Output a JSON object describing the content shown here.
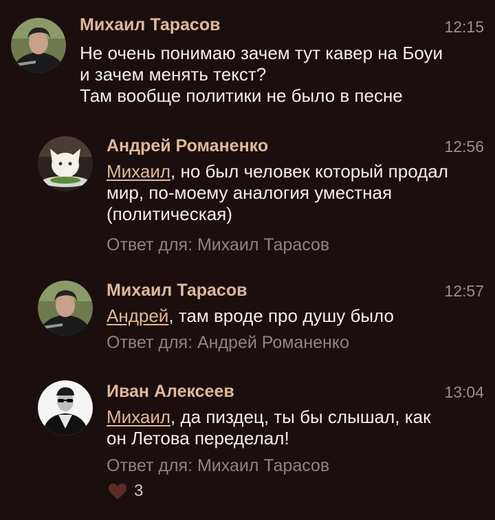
{
  "comments": [
    {
      "author": "Михаил Тарасов",
      "time": "12:15",
      "lines": [
        "Не очень понимаю зачем тут кавер на Боуи",
        "и зачем менять текст?",
        "Там вообще политики не было в песне"
      ],
      "avatar": "man-hoodie-avatar-icon"
    },
    {
      "author": "Андрей Романенко",
      "time": "12:56",
      "mention": "Михаил",
      "text_line1": ", но был человек который продал",
      "text_line2": "мир, по-моему аналогия уместная",
      "text_line3": "(политическая)",
      "reply_to": "Ответ для: Михаил Тарасов",
      "avatar": "white-cat-avatar-icon"
    },
    {
      "author": "Михаил Тарасов",
      "time": "12:57",
      "mention": "Андрей",
      "text_line1": ", там вроде про душу было",
      "reply_to": "Ответ для: Андрей Романенко",
      "avatar": "man-hoodie-avatar-icon"
    },
    {
      "author": "Иван Алексеев",
      "time": "13:04",
      "mention": "Михаил",
      "text_line1": ", да пиздец, ты бы слышал, как",
      "text_line2": "он Летова переделал!",
      "reply_to": "Ответ для: Михаил Тарасов",
      "likes": "3",
      "avatar": "sunglasses-man-avatar-icon"
    }
  ],
  "colors": {
    "background": "#1a0f0e",
    "author": "#e1b79a",
    "text": "#f2eeec",
    "muted": "#8c8382",
    "heart": "#5a2c24"
  }
}
